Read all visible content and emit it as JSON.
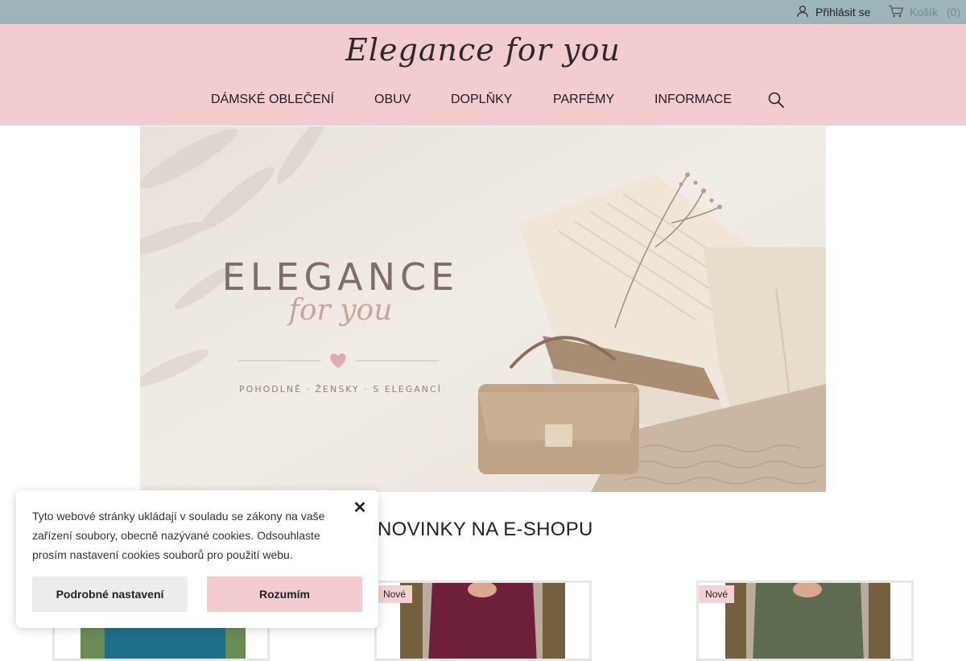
{
  "topbar": {
    "login_label": "Přihlásit se",
    "login_icon": "user-icon",
    "cart_label": "Košík",
    "cart_count": "(0)",
    "cart_icon": "cart-icon",
    "background_color": "#9bb5b9"
  },
  "header": {
    "logo_text": "Elegance for you",
    "background_color": "#f2cccf",
    "nav": [
      {
        "label": "DÁMSKÉ OBLEČENÍ"
      },
      {
        "label": "OBUV"
      },
      {
        "label": "DOPLŇKY"
      },
      {
        "label": "PARFÉMY"
      },
      {
        "label": "INFORMACE"
      }
    ],
    "search_icon": "search-icon"
  },
  "hero": {
    "brand": "ELEGANCE",
    "script": "for you",
    "tagline": "POHODLNĚ · ŽENSKY · S ELEGANCÍ",
    "heart_icon": "heart-icon"
  },
  "section": {
    "title": "NOVINKY NA E-SHOPU"
  },
  "products": [
    {
      "badge": "",
      "color": "#1e6f8a"
    },
    {
      "badge": "Nové",
      "color": "#6e1f3a"
    },
    {
      "badge": "Nové",
      "color": "#5f6b4e"
    }
  ],
  "cookie": {
    "text": "Tyto webové stránky ukládají v souladu se zákony na vaše zařízení soubory, obecně nazývané cookies. Odsouhlaste prosím nastavení cookies souborů pro použití webu.",
    "close_label": "✕",
    "settings_label": "Podrobné nastavení",
    "accept_label": "Rozumím"
  }
}
